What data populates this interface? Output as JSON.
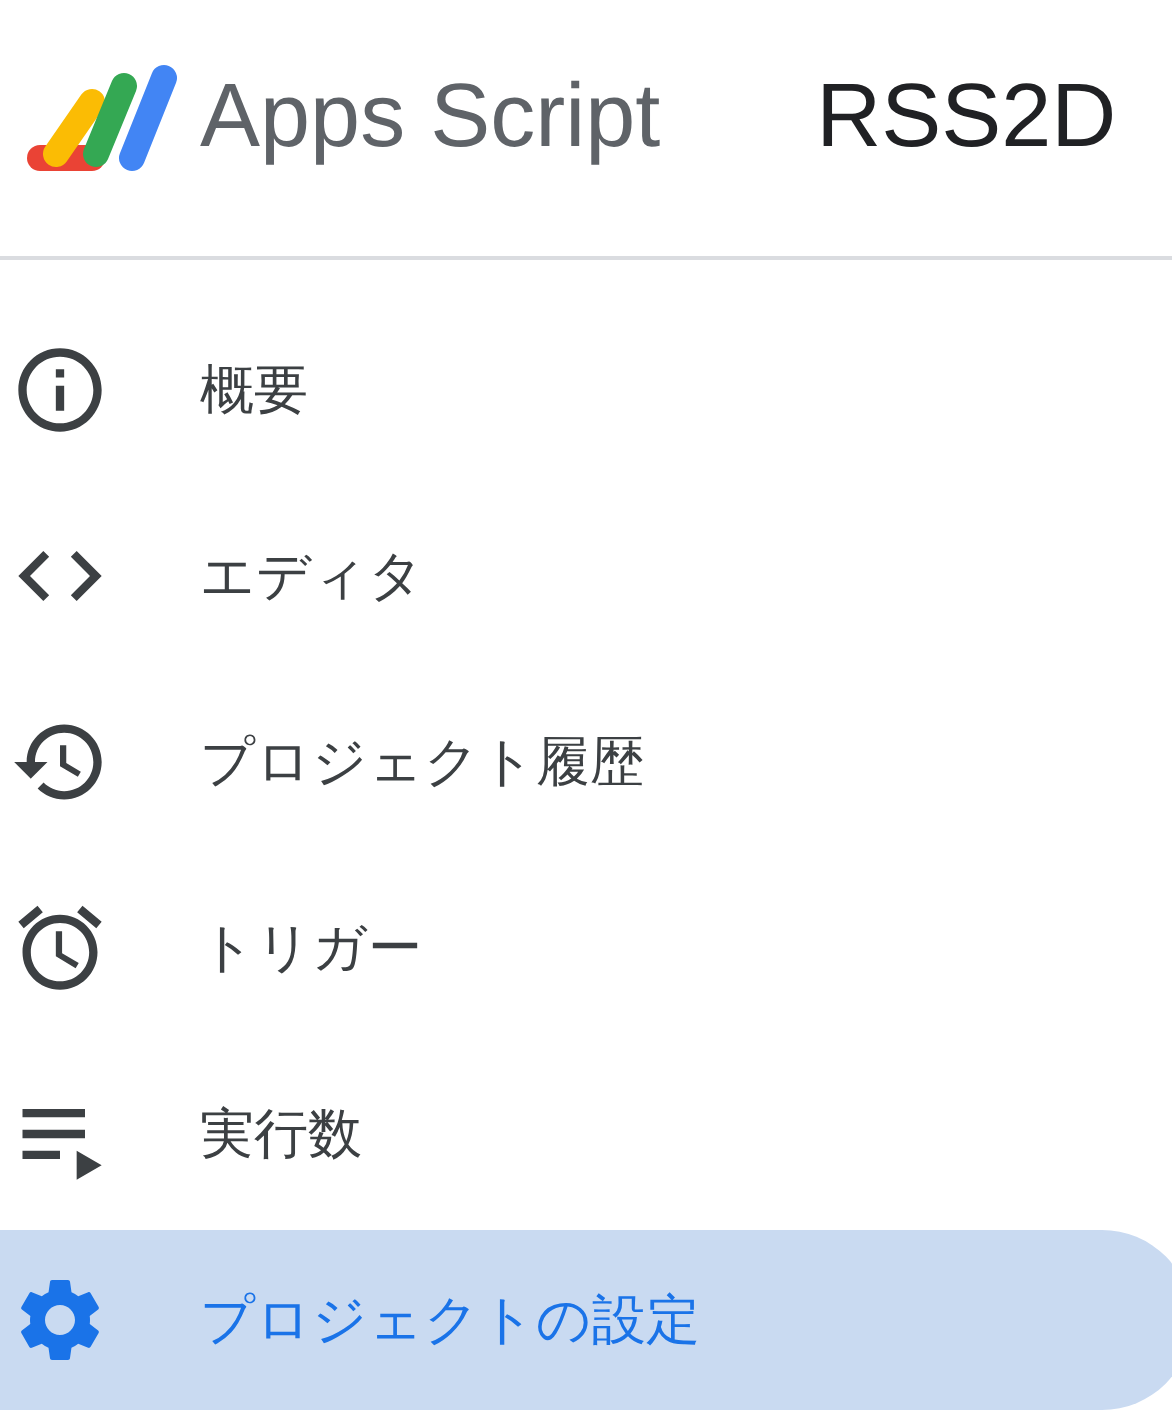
{
  "header": {
    "product": "Apps Script",
    "project_title": "RSS2D"
  },
  "nav": [
    {
      "label": "概要",
      "kind": "info",
      "selected": false
    },
    {
      "label": "エディタ",
      "kind": "code",
      "selected": false
    },
    {
      "label": "プロジェクト履歴",
      "kind": "history",
      "selected": false
    },
    {
      "label": "トリガー",
      "kind": "alarm",
      "selected": false
    },
    {
      "label": "実行数",
      "kind": "executions",
      "selected": false
    },
    {
      "label": "プロジェクトの設定",
      "kind": "settings",
      "selected": true
    }
  ]
}
